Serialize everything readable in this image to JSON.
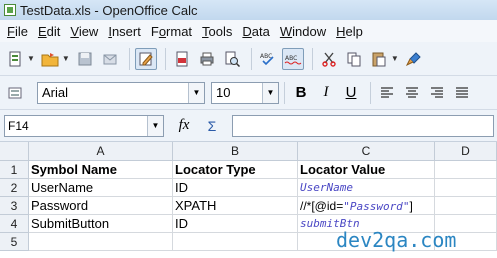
{
  "window": {
    "title": "TestData.xls - OpenOffice Calc"
  },
  "menu": [
    {
      "pre": "",
      "u": "F",
      "post": "ile"
    },
    {
      "pre": "",
      "u": "E",
      "post": "dit"
    },
    {
      "pre": "",
      "u": "V",
      "post": "iew"
    },
    {
      "pre": "",
      "u": "I",
      "post": "nsert"
    },
    {
      "pre": "F",
      "u": "o",
      "post": "rmat"
    },
    {
      "pre": "",
      "u": "T",
      "post": "ools"
    },
    {
      "pre": "",
      "u": "D",
      "post": "ata"
    },
    {
      "pre": "",
      "u": "W",
      "post": "indow"
    },
    {
      "pre": "",
      "u": "H",
      "post": "elp"
    }
  ],
  "toolbar2": {
    "font_name": "Arial",
    "font_size": "10",
    "bold": "B",
    "italic": "I",
    "underline": "U"
  },
  "formula": {
    "cell_ref": "F14",
    "fx": "fx",
    "sum": "Σ",
    "equals": "="
  },
  "columns": [
    "A",
    "B",
    "C",
    "D"
  ],
  "rows": [
    "1",
    "2",
    "3",
    "4",
    "5"
  ],
  "cells": {
    "a1": "Symbol Name",
    "b1": "Locator Type",
    "c1": "Locator Value",
    "a2": "UserName",
    "b2": "ID",
    "c2": "UserName",
    "a3": "Password",
    "b3": "XPATH",
    "c3_pre": "//*[@id=",
    "c3_q1": "\"",
    "c3_val": "Password",
    "c3_q2": "\"",
    "c3_post": "]",
    "a4": "SubmitButton",
    "b4": "ID",
    "c4": "submitBtn"
  },
  "watermark": "dev2qa.com",
  "colors": {
    "accent_blue": "#4a47c4",
    "watermark": "#2b86c2"
  }
}
